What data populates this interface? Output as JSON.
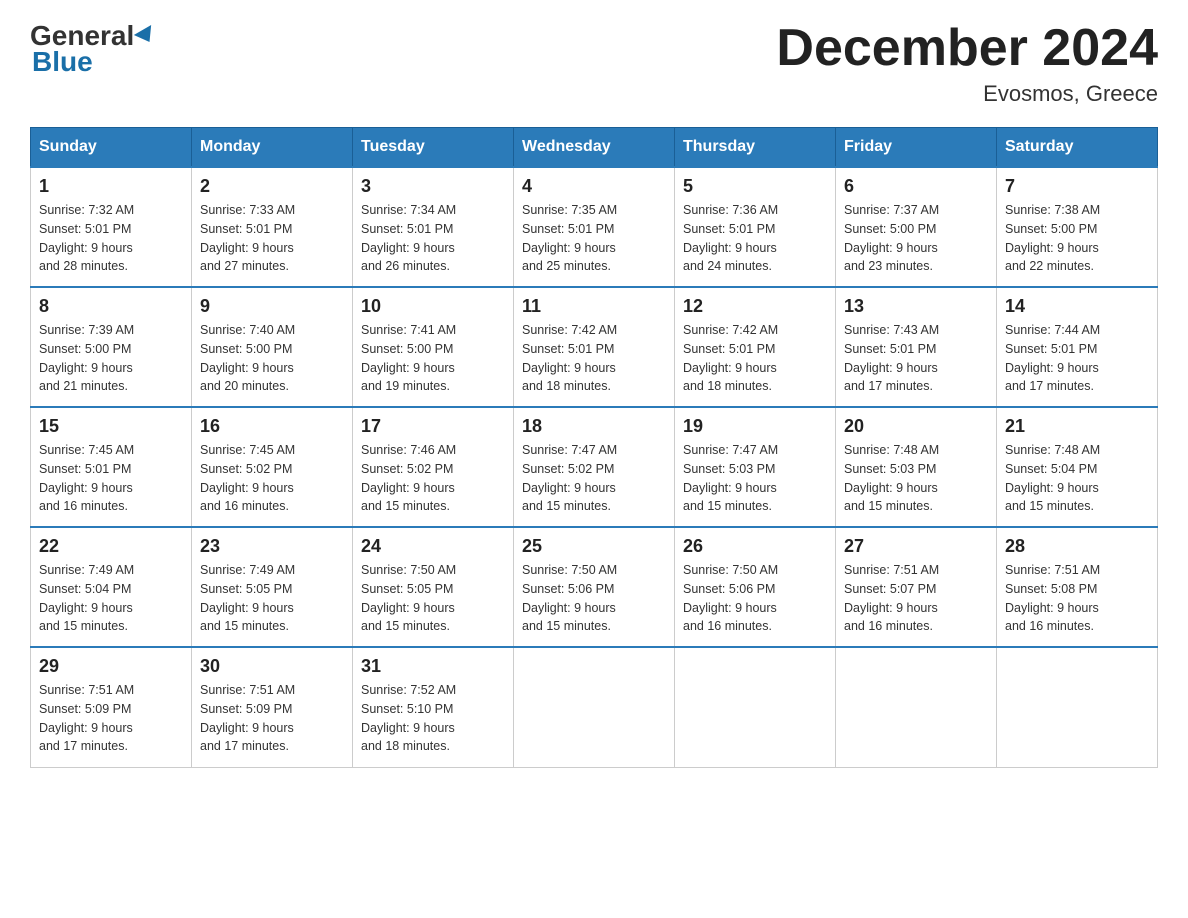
{
  "header": {
    "logo_general": "General",
    "logo_blue": "Blue",
    "month_title": "December 2024",
    "location": "Evosmos, Greece"
  },
  "days_of_week": [
    "Sunday",
    "Monday",
    "Tuesday",
    "Wednesday",
    "Thursday",
    "Friday",
    "Saturday"
  ],
  "weeks": [
    [
      {
        "num": "1",
        "sunrise": "7:32 AM",
        "sunset": "5:01 PM",
        "daylight": "9 hours and 28 minutes."
      },
      {
        "num": "2",
        "sunrise": "7:33 AM",
        "sunset": "5:01 PM",
        "daylight": "9 hours and 27 minutes."
      },
      {
        "num": "3",
        "sunrise": "7:34 AM",
        "sunset": "5:01 PM",
        "daylight": "9 hours and 26 minutes."
      },
      {
        "num": "4",
        "sunrise": "7:35 AM",
        "sunset": "5:01 PM",
        "daylight": "9 hours and 25 minutes."
      },
      {
        "num": "5",
        "sunrise": "7:36 AM",
        "sunset": "5:01 PM",
        "daylight": "9 hours and 24 minutes."
      },
      {
        "num": "6",
        "sunrise": "7:37 AM",
        "sunset": "5:00 PM",
        "daylight": "9 hours and 23 minutes."
      },
      {
        "num": "7",
        "sunrise": "7:38 AM",
        "sunset": "5:00 PM",
        "daylight": "9 hours and 22 minutes."
      }
    ],
    [
      {
        "num": "8",
        "sunrise": "7:39 AM",
        "sunset": "5:00 PM",
        "daylight": "9 hours and 21 minutes."
      },
      {
        "num": "9",
        "sunrise": "7:40 AM",
        "sunset": "5:00 PM",
        "daylight": "9 hours and 20 minutes."
      },
      {
        "num": "10",
        "sunrise": "7:41 AM",
        "sunset": "5:00 PM",
        "daylight": "9 hours and 19 minutes."
      },
      {
        "num": "11",
        "sunrise": "7:42 AM",
        "sunset": "5:01 PM",
        "daylight": "9 hours and 18 minutes."
      },
      {
        "num": "12",
        "sunrise": "7:42 AM",
        "sunset": "5:01 PM",
        "daylight": "9 hours and 18 minutes."
      },
      {
        "num": "13",
        "sunrise": "7:43 AM",
        "sunset": "5:01 PM",
        "daylight": "9 hours and 17 minutes."
      },
      {
        "num": "14",
        "sunrise": "7:44 AM",
        "sunset": "5:01 PM",
        "daylight": "9 hours and 17 minutes."
      }
    ],
    [
      {
        "num": "15",
        "sunrise": "7:45 AM",
        "sunset": "5:01 PM",
        "daylight": "9 hours and 16 minutes."
      },
      {
        "num": "16",
        "sunrise": "7:45 AM",
        "sunset": "5:02 PM",
        "daylight": "9 hours and 16 minutes."
      },
      {
        "num": "17",
        "sunrise": "7:46 AM",
        "sunset": "5:02 PM",
        "daylight": "9 hours and 15 minutes."
      },
      {
        "num": "18",
        "sunrise": "7:47 AM",
        "sunset": "5:02 PM",
        "daylight": "9 hours and 15 minutes."
      },
      {
        "num": "19",
        "sunrise": "7:47 AM",
        "sunset": "5:03 PM",
        "daylight": "9 hours and 15 minutes."
      },
      {
        "num": "20",
        "sunrise": "7:48 AM",
        "sunset": "5:03 PM",
        "daylight": "9 hours and 15 minutes."
      },
      {
        "num": "21",
        "sunrise": "7:48 AM",
        "sunset": "5:04 PM",
        "daylight": "9 hours and 15 minutes."
      }
    ],
    [
      {
        "num": "22",
        "sunrise": "7:49 AM",
        "sunset": "5:04 PM",
        "daylight": "9 hours and 15 minutes."
      },
      {
        "num": "23",
        "sunrise": "7:49 AM",
        "sunset": "5:05 PM",
        "daylight": "9 hours and 15 minutes."
      },
      {
        "num": "24",
        "sunrise": "7:50 AM",
        "sunset": "5:05 PM",
        "daylight": "9 hours and 15 minutes."
      },
      {
        "num": "25",
        "sunrise": "7:50 AM",
        "sunset": "5:06 PM",
        "daylight": "9 hours and 15 minutes."
      },
      {
        "num": "26",
        "sunrise": "7:50 AM",
        "sunset": "5:06 PM",
        "daylight": "9 hours and 16 minutes."
      },
      {
        "num": "27",
        "sunrise": "7:51 AM",
        "sunset": "5:07 PM",
        "daylight": "9 hours and 16 minutes."
      },
      {
        "num": "28",
        "sunrise": "7:51 AM",
        "sunset": "5:08 PM",
        "daylight": "9 hours and 16 minutes."
      }
    ],
    [
      {
        "num": "29",
        "sunrise": "7:51 AM",
        "sunset": "5:09 PM",
        "daylight": "9 hours and 17 minutes."
      },
      {
        "num": "30",
        "sunrise": "7:51 AM",
        "sunset": "5:09 PM",
        "daylight": "9 hours and 17 minutes."
      },
      {
        "num": "31",
        "sunrise": "7:52 AM",
        "sunset": "5:10 PM",
        "daylight": "9 hours and 18 minutes."
      },
      null,
      null,
      null,
      null
    ]
  ],
  "labels": {
    "sunrise": "Sunrise:",
    "sunset": "Sunset:",
    "daylight": "Daylight:"
  }
}
